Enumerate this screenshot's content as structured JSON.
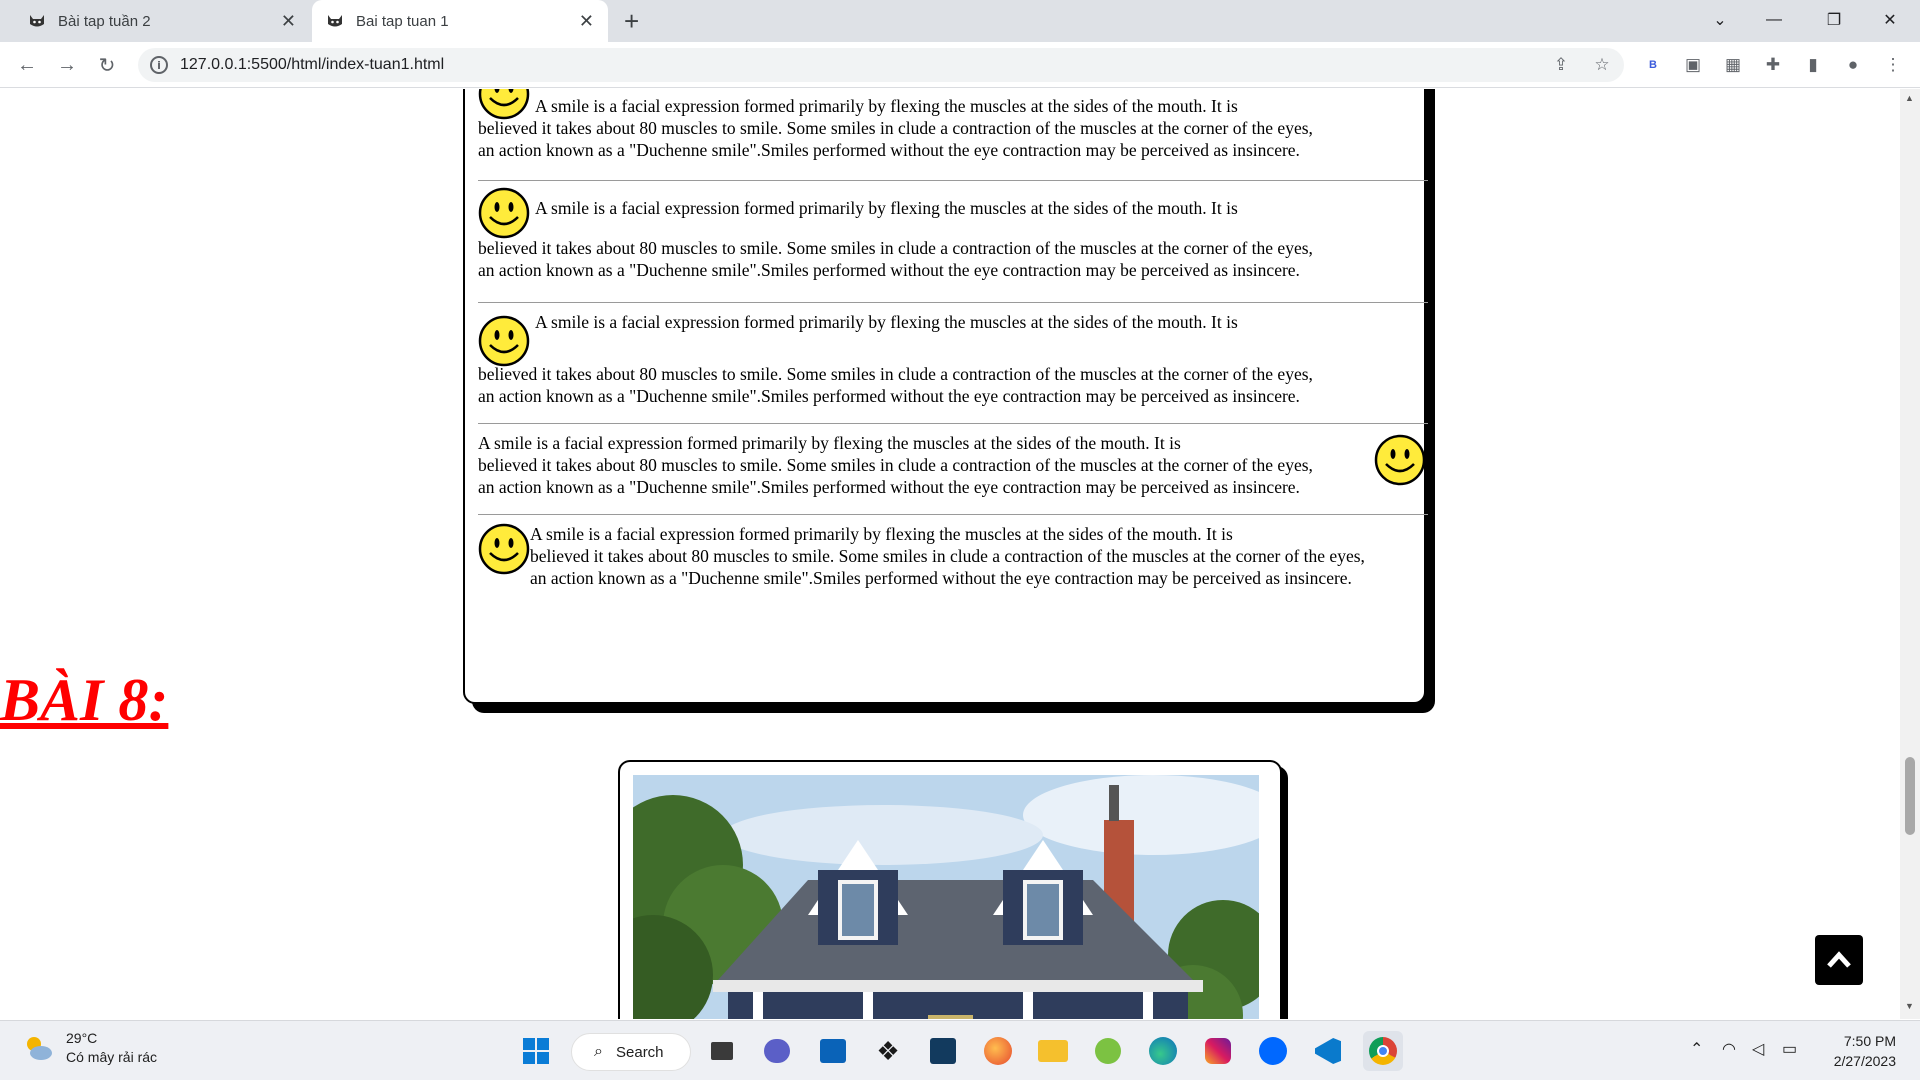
{
  "browser": {
    "tabs": [
      {
        "label": "Bài tap tuần 2",
        "active": false
      },
      {
        "label": "Bai tap tuan 1",
        "active": true
      }
    ],
    "url": "127.0.0.1:5500/html/index-tuan1.html",
    "extension_badge": "B"
  },
  "page": {
    "paragraph": {
      "line1": "A smile is a facial expression formed primarily by flexing the muscles at the sides of the mouth. It is",
      "line2": "believed it takes about 80 muscles to smile. Some smiles in clude a contraction of the muscles at the corner of the eyes,",
      "line3": "an action known as a \"Duchenne smile\".Smiles performed without the eye contraction may be perceived as insincere."
    },
    "heading": "BÀI 8:"
  },
  "taskbar": {
    "temperature": "29°C",
    "weather_desc": "Có mây rải rác",
    "search_label": "Search",
    "time": "7:50 PM",
    "date": "2/27/2023"
  },
  "colors": {
    "heading": "#ff0000",
    "smiley_face": "#ffeb3b",
    "tab_bar": "#dee1e6",
    "taskbar": "#eef0f4"
  }
}
